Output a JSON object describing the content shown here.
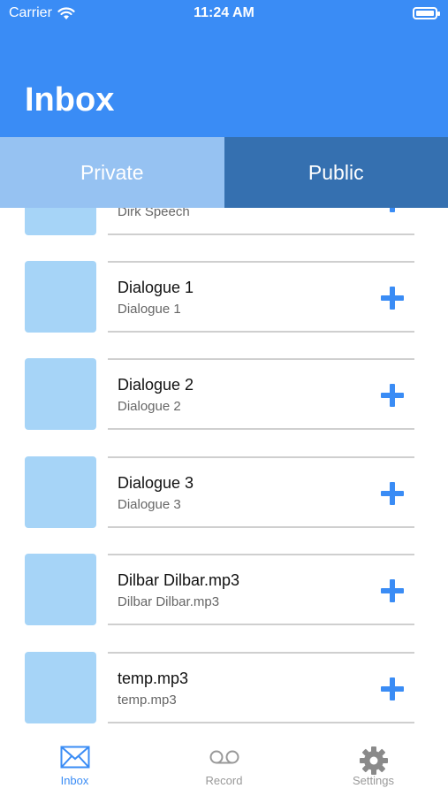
{
  "status_bar": {
    "carrier": "Carrier",
    "time": "11:24 AM"
  },
  "header": {
    "title": "Inbox"
  },
  "segments": [
    {
      "label": "Private",
      "selected": true
    },
    {
      "label": "Public",
      "selected": false
    }
  ],
  "list": {
    "items": [
      {
        "title": "",
        "subtitle": "Dirk Speech"
      },
      {
        "title": "Dialogue 1",
        "subtitle": "Dialogue 1"
      },
      {
        "title": "Dialogue 2",
        "subtitle": "Dialogue 2"
      },
      {
        "title": "Dialogue 3",
        "subtitle": "Dialogue 3"
      },
      {
        "title": "Dilbar Dilbar.mp3",
        "subtitle": "Dilbar Dilbar.mp3"
      },
      {
        "title": "temp.mp3",
        "subtitle": "temp.mp3"
      }
    ],
    "item_icon": "plus-icon"
  },
  "tabbar": {
    "items": [
      {
        "label": "Inbox",
        "icon": "envelope-icon",
        "active": true
      },
      {
        "label": "Record",
        "icon": "voicemail-icon",
        "active": false
      },
      {
        "label": "Settings",
        "icon": "gear-icon",
        "active": false
      }
    ]
  },
  "colors": {
    "accent": "#3a8cf5",
    "segment_private": "#96c2f2",
    "segment_public": "#3570b0",
    "thumbnail": "#a6d4f7"
  }
}
